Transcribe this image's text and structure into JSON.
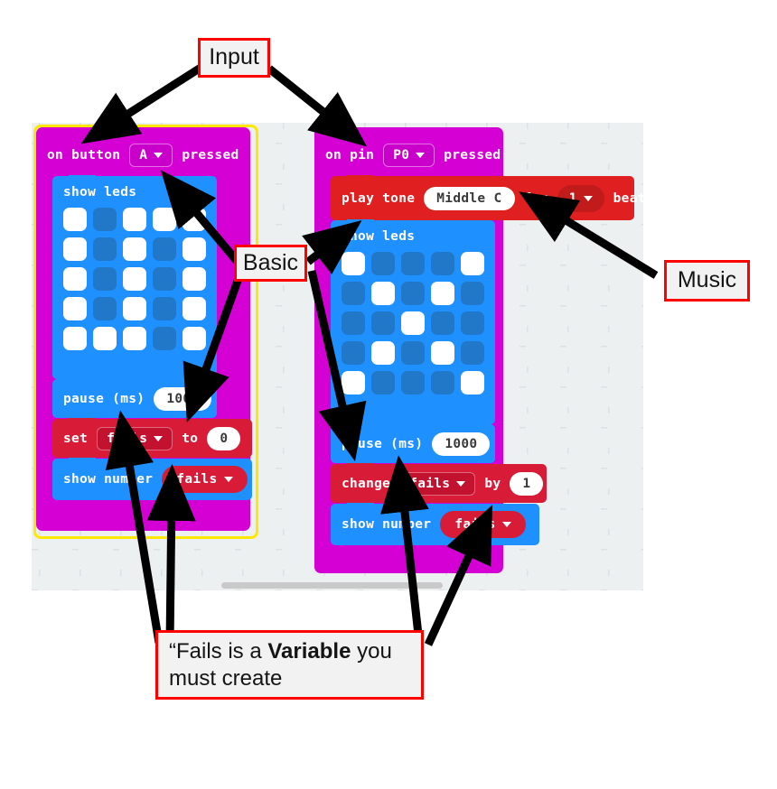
{
  "annotations": {
    "input_label": "Input",
    "basic_label": "Basic",
    "music_label": "Music",
    "caption_prefix": "“Fails is a ",
    "caption_bold": "Variable",
    "caption_suffix": " you must create"
  },
  "left_stack": {
    "selected": true,
    "event": {
      "text_before": "on button",
      "dropdown_value": "A",
      "text_after": "pressed"
    },
    "show_leds": {
      "label": "show leds",
      "pattern": [
        [
          1,
          0,
          1,
          1,
          1
        ],
        [
          1,
          0,
          1,
          0,
          1
        ],
        [
          1,
          0,
          1,
          0,
          1
        ],
        [
          1,
          0,
          1,
          0,
          1
        ],
        [
          1,
          1,
          1,
          0,
          1
        ]
      ]
    },
    "pause": {
      "label": "pause (ms)",
      "value": "1000"
    },
    "set_var": {
      "label": "set",
      "variable": "fails",
      "to_label": "to",
      "value": "0"
    },
    "show_number": {
      "label": "show number",
      "variable": "fails"
    }
  },
  "right_stack": {
    "selected": false,
    "event": {
      "text_before": "on pin",
      "dropdown_value": "P0",
      "text_after": "pressed"
    },
    "play_tone": {
      "label": "play tone",
      "note": "Middle C",
      "for_label": "for",
      "beats": "1",
      "beat_label": "beat"
    },
    "show_leds": {
      "label": "show leds",
      "pattern": [
        [
          1,
          0,
          0,
          0,
          1
        ],
        [
          0,
          1,
          0,
          1,
          0
        ],
        [
          0,
          0,
          1,
          0,
          0
        ],
        [
          0,
          1,
          0,
          1,
          0
        ],
        [
          1,
          0,
          0,
          0,
          1
        ]
      ]
    },
    "pause": {
      "label": "pause (ms)",
      "value": "1000"
    },
    "change_var": {
      "label": "change",
      "variable": "fails",
      "by_label": "by",
      "value": "1"
    },
    "show_number": {
      "label": "show number",
      "variable": "fails"
    }
  },
  "colors": {
    "event": "#d400d4",
    "basic": "#1e90ff",
    "music": "#e02020",
    "variables": "#d81c38",
    "led_on": "#ffffff",
    "led_off": "#2278c8",
    "selection": "#ffe800",
    "callout_border": "#ff0000",
    "canvas_bg": "#ecf0f1"
  }
}
